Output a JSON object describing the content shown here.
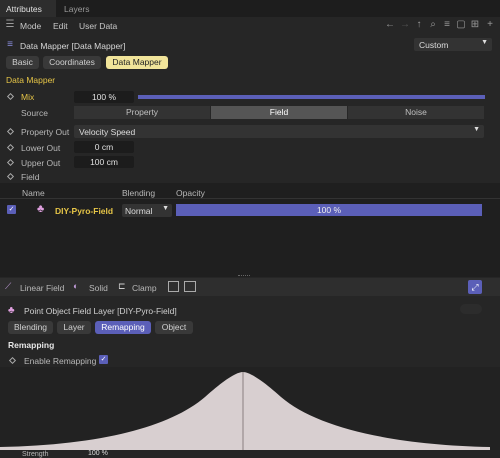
{
  "tabs": {
    "attributes": "Attributes",
    "layers": "Layers"
  },
  "menu": {
    "mode": "Mode",
    "edit": "Edit",
    "user_data": "User Data"
  },
  "object_title": "Data Mapper [Data Mapper]",
  "preset_dropdown": "Custom",
  "subtabs": {
    "basic": "Basic",
    "coordinates": "Coordinates",
    "data_mapper": "Data Mapper"
  },
  "section_title": "Data Mapper",
  "mix": {
    "label": "Mix",
    "value": "100 %",
    "level": 1.0
  },
  "source": {
    "label": "Source",
    "options": [
      "Property",
      "Field",
      "Noise"
    ],
    "selected": "Field"
  },
  "property_out": {
    "label": "Property Out",
    "value": "Velocity Speed"
  },
  "lower_out": {
    "label": "Lower Out",
    "value": "0 cm"
  },
  "upper_out": {
    "label": "Upper Out",
    "value": "100 cm"
  },
  "field_label": "Field",
  "list_headers": {
    "name": "Name",
    "blending": "Blending",
    "opacity": "Opacity"
  },
  "field_row": {
    "name": "DIY-Pyro-Field",
    "blending": "Normal",
    "opacity": "100 %"
  },
  "field_toolbar": {
    "linear": "Linear Field",
    "solid": "Solid",
    "clamp": "Clamp"
  },
  "layer_title": "Point Object Field Layer [DIY-Pyro-Field]",
  "layer_tabs": {
    "blending": "Blending",
    "layer": "Layer",
    "remapping": "Remapping",
    "object": "Object"
  },
  "remap_section": "Remapping",
  "enable_remap": {
    "label": "Enable Remapping",
    "checked": true
  },
  "strength_partial": "Strength",
  "strength_value": "100 %",
  "colors": {
    "accent": "#5b5fb8",
    "highlight": "#f1e49a",
    "section": "#e6c547"
  }
}
